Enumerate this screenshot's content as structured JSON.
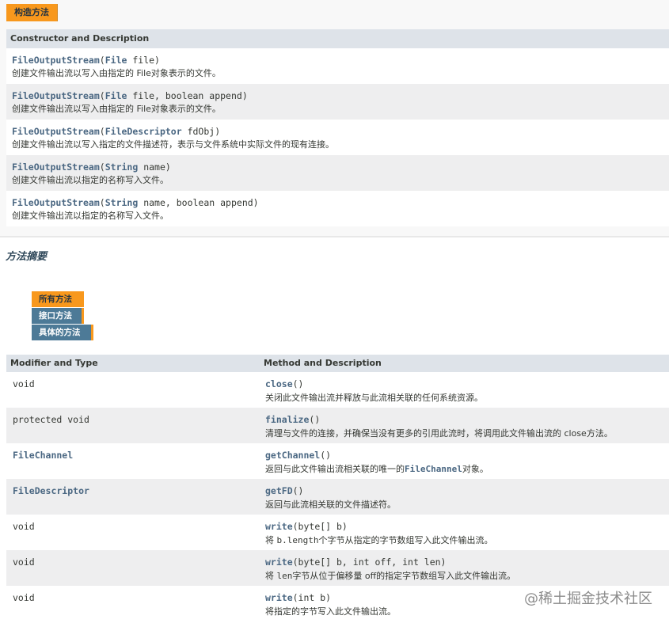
{
  "constructor_tab": "构造方法",
  "constructor_table": {
    "header": "Constructor and Description",
    "rows": [
      {
        "name": "FileOutputStream",
        "open": "(",
        "ptype": "File",
        "params": " file)",
        "desc": "创建文件输出流以写入由指定的 File对象表示的文件。"
      },
      {
        "name": "FileOutputStream",
        "open": "(",
        "ptype": "File",
        "params": " file, boolean append)",
        "desc": "创建文件输出流以写入由指定的 File对象表示的文件。"
      },
      {
        "name": "FileOutputStream",
        "open": "(",
        "ptype": "FileDescriptor",
        "params": " fdObj)",
        "desc": "创建文件输出流以写入指定的文件描述符，表示与文件系统中实际文件的现有连接。"
      },
      {
        "name": "FileOutputStream",
        "open": "(",
        "ptype": "String",
        "params": " name)",
        "desc": "创建文件输出流以指定的名称写入文件。"
      },
      {
        "name": "FileOutputStream",
        "open": "(",
        "ptype": "String",
        "params": " name, boolean append)",
        "desc": "创建文件输出流以指定的名称写入文件。"
      }
    ]
  },
  "method_summary": {
    "title": "方法摘要",
    "tabs": [
      "所有方法",
      "接口方法",
      "具体的方法"
    ],
    "headers": {
      "type": "Modifier and Type",
      "method": "Method and Description"
    },
    "rows": [
      {
        "type": "void",
        "name": "close",
        "params": "()",
        "desc": "关闭此文件输出流并释放与此流相关联的任何系统资源。"
      },
      {
        "type": "protected void",
        "name": "finalize",
        "params": "()",
        "desc": "清理与文件的连接，并确保当没有更多的引用此流时，将调用此文件输出流的 close方法。"
      },
      {
        "type": "FileChannel",
        "name": "getChannel",
        "params": "()",
        "desc_pre": "返回与此文件输出流相关联的唯一的",
        "desc_code": "FileChannel",
        "desc_post": "对象。"
      },
      {
        "type": "FileDescriptor",
        "name": "getFD",
        "params": "()",
        "desc": "返回与此流相关联的文件描述符。"
      },
      {
        "type": "void",
        "name": "write",
        "params": "(byte[] b)",
        "desc_pre": "将 ",
        "desc_code": "b.length",
        "desc_post": "个字节从指定的字节数组写入此文件输出流。"
      },
      {
        "type": "void",
        "name": "write",
        "params": "(byte[] b, int off, int len)",
        "desc_pre": "将 ",
        "desc_code": "len",
        "desc_post": "字节从位于偏移量 off的指定字节数组写入此文件输出流。"
      },
      {
        "type": "void",
        "name": "write",
        "params": "(int b)",
        "desc": "将指定的字节写入此文件输出流。"
      }
    ]
  },
  "watermark": "@稀土掘金技术社区"
}
